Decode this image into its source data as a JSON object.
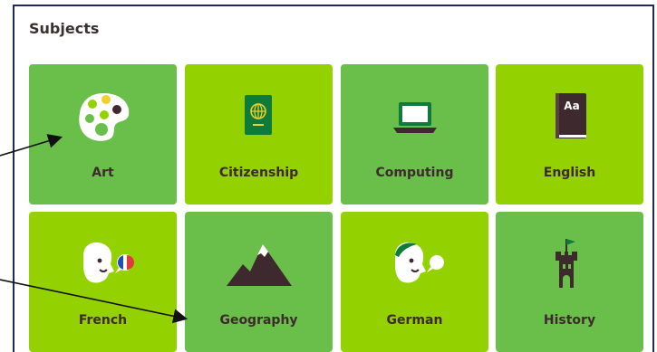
{
  "panel": {
    "title": "Subjects"
  },
  "colors": {
    "tile_dark": "#6abf4b",
    "tile_light": "#94d100",
    "text": "#3e2a2e",
    "frame": "#1f2a5a"
  },
  "subjects": [
    {
      "label": "Art",
      "icon": "palette-icon",
      "shade": "dark"
    },
    {
      "label": "Citizenship",
      "icon": "passport-icon",
      "shade": "light"
    },
    {
      "label": "Computing",
      "icon": "laptop-icon",
      "shade": "dark"
    },
    {
      "label": "English",
      "icon": "book-icon",
      "shade": "light"
    },
    {
      "label": "French",
      "icon": "french-speaker-icon",
      "shade": "light"
    },
    {
      "label": "Geography",
      "icon": "mountain-icon",
      "shade": "dark"
    },
    {
      "label": "German",
      "icon": "german-speaker-icon",
      "shade": "light"
    },
    {
      "label": "History",
      "icon": "castle-icon",
      "shade": "dark"
    }
  ]
}
